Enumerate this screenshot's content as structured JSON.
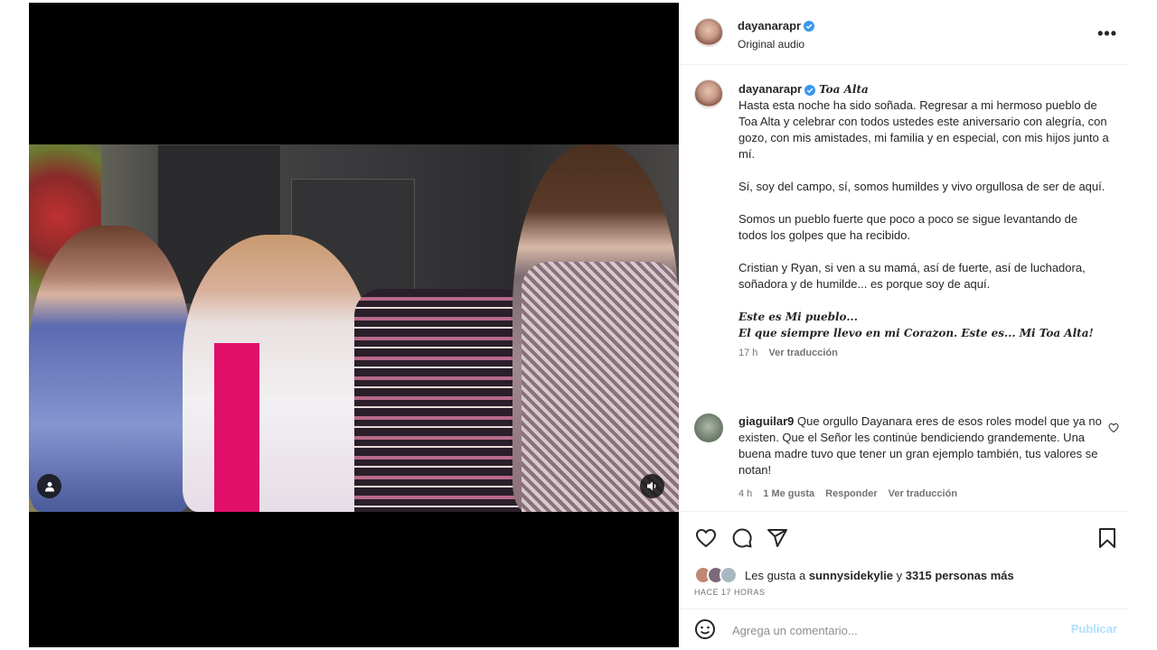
{
  "post": {
    "username": "dayanarapr",
    "audio": "Original audio",
    "more_label": "•••"
  },
  "caption": {
    "username": "dayanarapr",
    "location": "Toa Alta",
    "p1": "Hasta esta noche ha sido soñada. Regresar a mi hermoso pueblo de Toa Alta y celebrar con todos ustedes este aniversario con alegría, con gozo, con mis amistades, mi familia y en especial, con mis hijos junto a mí.",
    "p2": "Sí, soy del campo, sí, somos humildes y vivo orgullosa de ser de aquí.",
    "p3": "Somos un pueblo fuerte que poco a poco se sigue levantando de todos los golpes que ha recibido.",
    "p4": "Cristian y Ryan, si ven a su mamá, así de fuerte, así de luchadora, soñadora y de humilde... es porque soy de aquí.",
    "p5_line1": "Este es Mi pueblo...",
    "p5_line2": "El que siempre llevo en mi Corazon. Este es... Mi Toa Alta!",
    "time": "17 h",
    "translate": "Ver traducción"
  },
  "comment": {
    "username": "giaguilar9",
    "text": "Que orgullo Dayanara eres de esos roles model que ya no existen. Que el Señor les continúe bendiciendo grandemente. Una buena madre tuvo que tener un gran ejemplo también, tus valores se notan!",
    "time": "4 h",
    "likes": "1 Me gusta",
    "reply": "Responder",
    "translate": "Ver traducción"
  },
  "likes": {
    "prefix": "Les gusta a ",
    "user": "sunnysidekylie",
    "middle": " y ",
    "count": "3315 personas más"
  },
  "timestamp": "HACE 17 HORAS",
  "add_comment": {
    "placeholder": "Agrega un comentario...",
    "publish": "Publicar"
  },
  "icons": {
    "verified_color": "#3897f0",
    "like": "heart-icon",
    "comment": "comment-icon",
    "share": "share-icon",
    "save": "bookmark-icon",
    "emoji": "emoji-icon"
  }
}
